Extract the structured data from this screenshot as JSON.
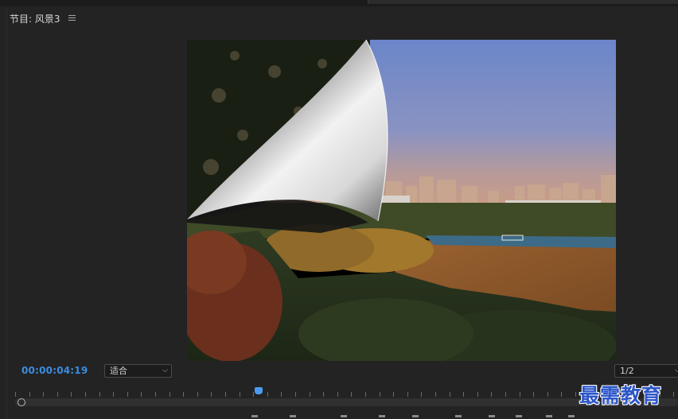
{
  "panel": {
    "title": "节目: 风景3",
    "menu_icon": "hamburger-menu-icon"
  },
  "viewer": {
    "content": "page-peel-transition-preview"
  },
  "controls": {
    "timecode": "00:00:04:19",
    "fit": {
      "selected": "适合"
    },
    "resolution": {
      "selected": "1/2"
    }
  },
  "watermark": {
    "text": "最需教育"
  },
  "colors": {
    "timecode": "#3b8de0",
    "playhead": "#4b9cf0",
    "watermark": "#2c56c9",
    "panel_bg": "#232323"
  }
}
